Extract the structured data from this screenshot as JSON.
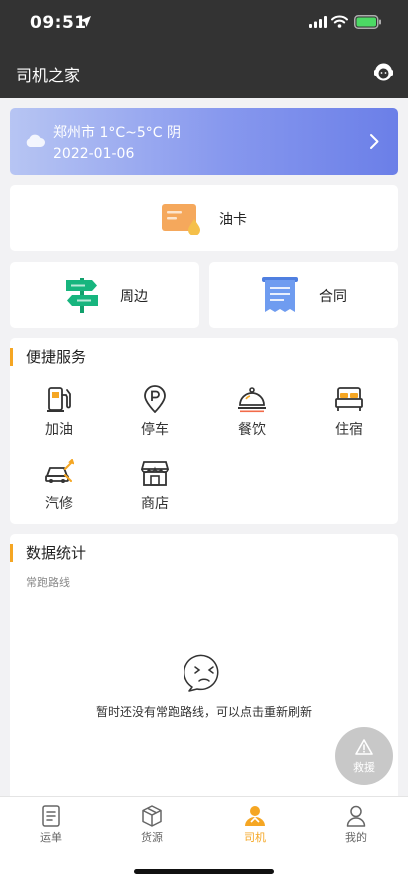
{
  "status_bar": {
    "time": "09:51"
  },
  "navbar": {
    "title": "司机之家"
  },
  "weather": {
    "city_temp": "郑州市  1°C~5°C  阴",
    "date": "2022-01-06"
  },
  "fuel_card": {
    "label": "油卡"
  },
  "surroundings": {
    "label": "周边"
  },
  "contract": {
    "label": "合同"
  },
  "quick_services": {
    "title": "便捷服务",
    "items": [
      {
        "label": "加油",
        "icon": "fuel-pump-icon"
      },
      {
        "label": "停车",
        "icon": "parking-icon"
      },
      {
        "label": "餐饮",
        "icon": "dining-icon"
      },
      {
        "label": "住宿",
        "icon": "bed-icon"
      },
      {
        "label": "汽修",
        "icon": "car-repair-icon"
      },
      {
        "label": "商店",
        "icon": "store-icon"
      }
    ]
  },
  "statistics": {
    "title": "数据统计",
    "subtitle": "常跑路线",
    "empty_text": "暂时还没有常跑路线，可以点击重新刷新"
  },
  "fab": {
    "label": "救援"
  },
  "tabbar": {
    "tabs": [
      {
        "label": "运单",
        "icon": "waybill-icon"
      },
      {
        "label": "货源",
        "icon": "cargo-box-icon"
      },
      {
        "label": "司机",
        "icon": "driver-icon"
      },
      {
        "label": "我的",
        "icon": "profile-icon"
      }
    ],
    "active_color": "#f5a623"
  },
  "colors": {
    "accent": "#f5a623",
    "header_bg": "#333333",
    "weather_gradient_end": "#6b7fe8"
  }
}
